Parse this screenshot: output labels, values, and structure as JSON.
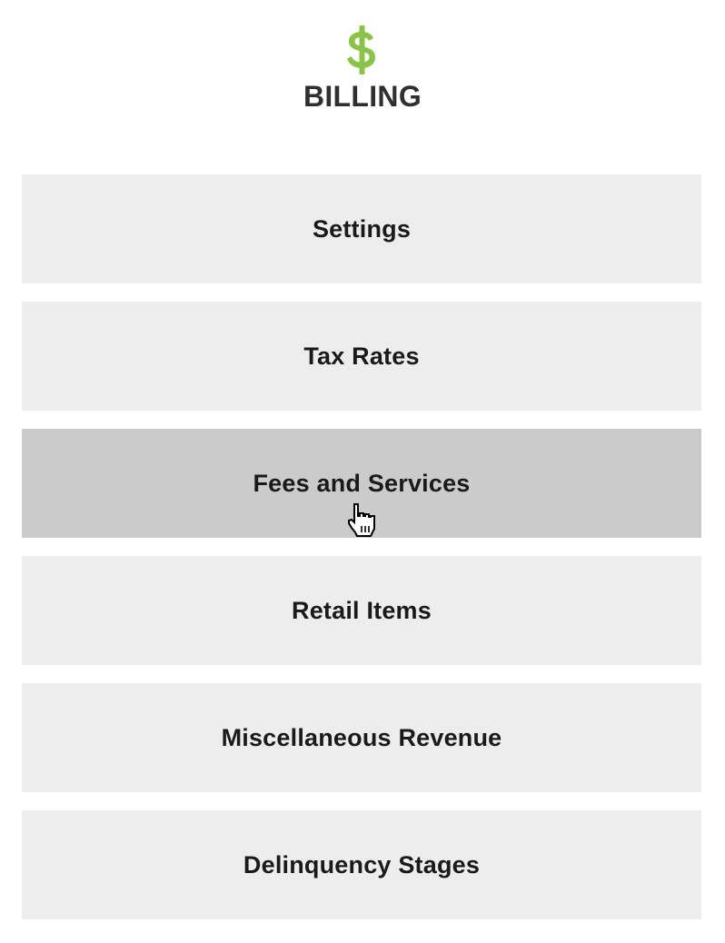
{
  "header": {
    "icon": "dollar-sign-icon",
    "icon_color": "#8bc34a",
    "title": "BILLING"
  },
  "menu": {
    "items": [
      {
        "label": "Settings",
        "state": "default"
      },
      {
        "label": "Tax Rates",
        "state": "default"
      },
      {
        "label": "Fees and Services",
        "state": "hover"
      },
      {
        "label": "Retail Items",
        "state": "default"
      },
      {
        "label": "Miscellaneous Revenue",
        "state": "default"
      },
      {
        "label": "Delinquency Stages",
        "state": "default"
      }
    ]
  },
  "colors": {
    "item_background": "#ededed",
    "item_hover_background": "#cbcbcb",
    "text": "#1a1a1a",
    "title_text": "#2f2f2f"
  },
  "cursor": {
    "icon": "hand-pointer-icon"
  }
}
